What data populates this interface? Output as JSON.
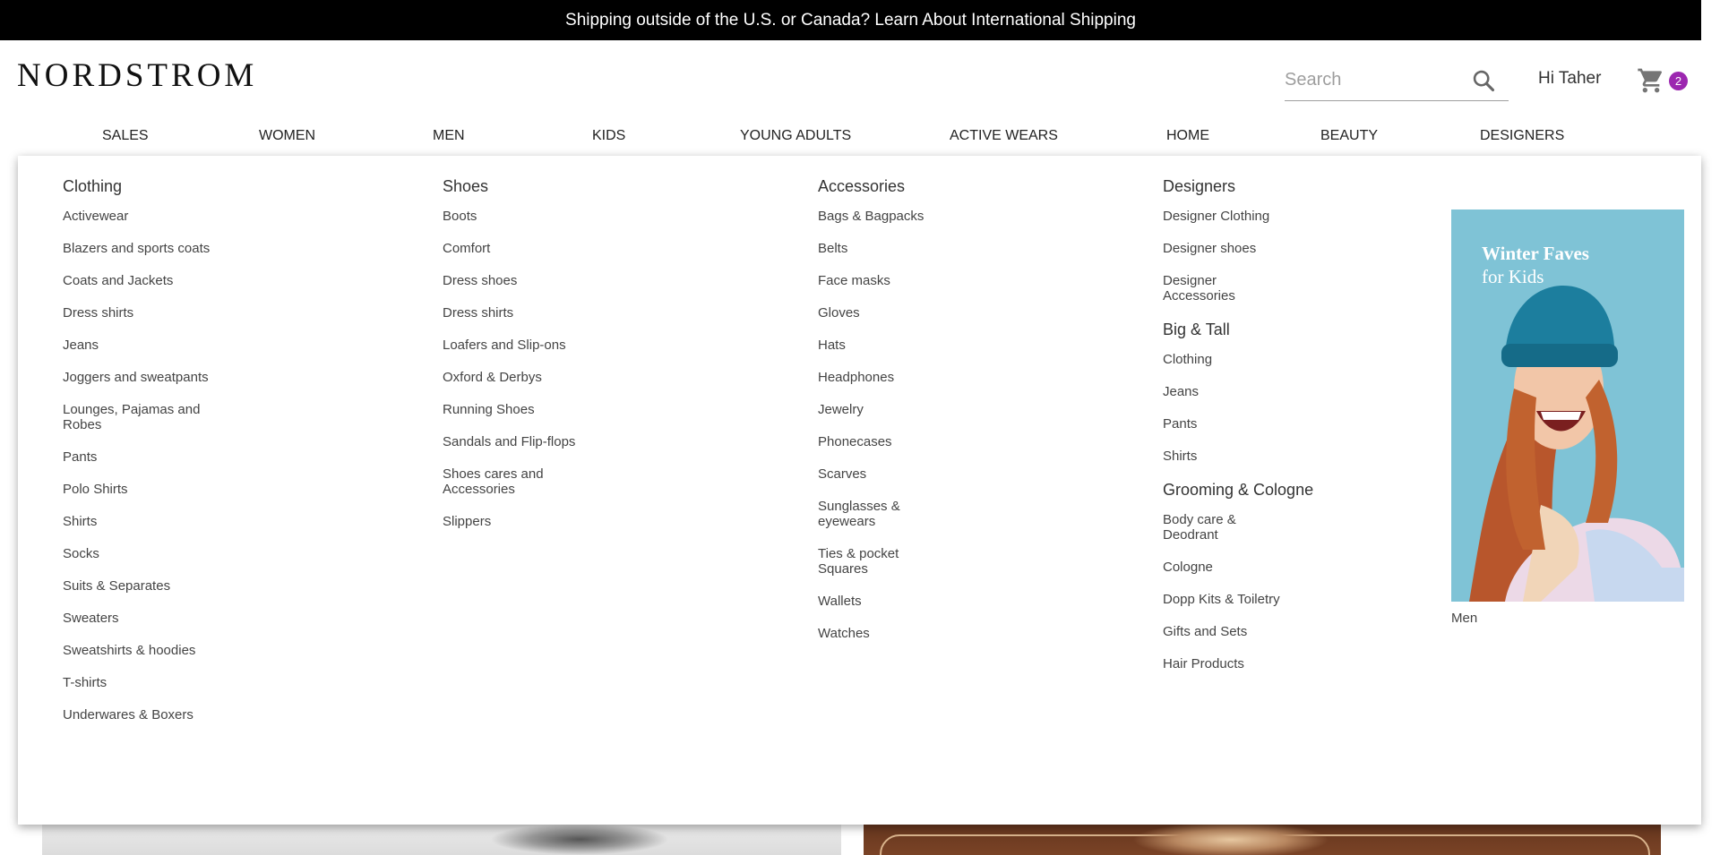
{
  "banner": {
    "text": "Shipping outside of the U.S. or Canada? Learn About International Shipping"
  },
  "header": {
    "logo": "NORDSTROM",
    "search_placeholder": "Search",
    "greeting": "Hi Taher",
    "cart_count": "2"
  },
  "nav": {
    "items": [
      {
        "label": "SALES"
      },
      {
        "label": "WOMEN"
      },
      {
        "label": "MEN"
      },
      {
        "label": "KIDS"
      },
      {
        "label": "YOUNG ADULTS"
      },
      {
        "label": "ACTIVE WEARS"
      },
      {
        "label": "HOME"
      },
      {
        "label": "BEAUTY"
      },
      {
        "label": "DESIGNERS"
      }
    ]
  },
  "menu": {
    "clothing": {
      "heading": "Clothing",
      "items": [
        "Activewear",
        "Blazers and sports coats",
        "Coats and Jackets",
        "Dress shirts",
        "Jeans",
        "Joggers and sweatpants",
        "Lounges, Pajamas and Robes",
        "Pants",
        "Polo Shirts",
        "Shirts",
        "Socks",
        "Suits & Separates",
        "Sweaters",
        "Sweatshirts & hoodies",
        "T-shirts",
        "Underwares & Boxers"
      ]
    },
    "shoes": {
      "heading": "Shoes",
      "items": [
        "Boots",
        "Comfort",
        "Dress shoes",
        "Dress shirts",
        "Loafers and Slip-ons",
        "Oxford & Derbys",
        "Running Shoes",
        "Sandals and Flip-flops",
        "Shoes cares and Accessories",
        "Slippers"
      ]
    },
    "accessories": {
      "heading": "Accessories",
      "items": [
        "Bags & Bagpacks",
        "Belts",
        "Face masks",
        "Gloves",
        "Hats",
        "Headphones",
        "Jewelry",
        "Phonecases",
        "Scarves",
        "Sunglasses & eyewears",
        "Ties & pocket Squares",
        "Wallets",
        "Watches"
      ]
    },
    "designers": {
      "heading": "Designers",
      "items": [
        "Designer Clothing",
        "Designer shoes",
        "Designer Accessories"
      ]
    },
    "big_tall": {
      "heading": "Big & Tall",
      "items": [
        "Clothing",
        "Jeans",
        "Pants",
        "Shirts"
      ]
    },
    "grooming": {
      "heading": "Grooming & Cologne",
      "items": [
        "Body care & Deodrant",
        "Cologne",
        "Dopp Kits & Toiletry",
        "Gifts and Sets",
        "Hair Products"
      ]
    },
    "promo": {
      "title_line1": "Winter Faves",
      "title_line2": "for Kids",
      "caption": "Men"
    }
  }
}
